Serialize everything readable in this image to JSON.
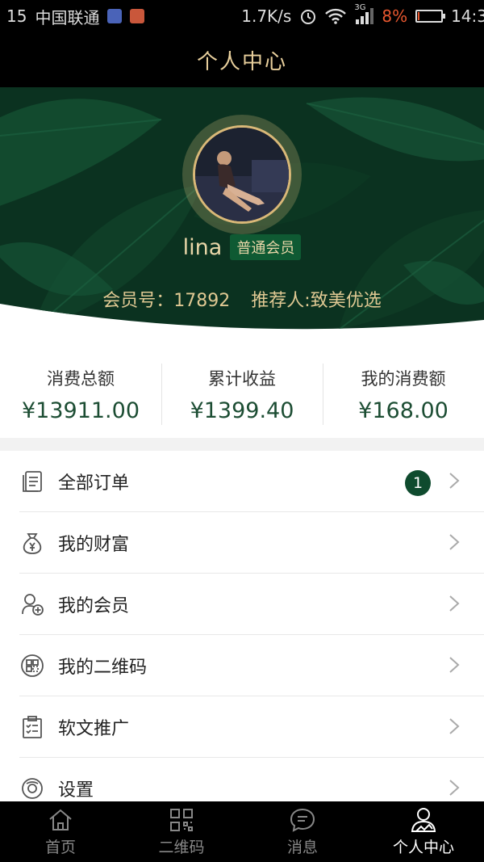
{
  "status_bar": {
    "left_number": "15",
    "carrier": "中国联通",
    "speed": "1.7K/s",
    "network": "3G",
    "battery_percent": "8%",
    "battery_level": 0.08,
    "time": "14:3"
  },
  "header": {
    "title": "个人中心"
  },
  "profile": {
    "username": "lina",
    "level": "普通会员",
    "member_no": "会员号：17892",
    "referrer": "推荐人:致美优选"
  },
  "stats": [
    {
      "label": "消费总额",
      "value": "¥13911.00"
    },
    {
      "label": "累计收益",
      "value": "¥1399.40"
    },
    {
      "label": "我的消费额",
      "value": "¥168.00"
    }
  ],
  "menu": {
    "items": [
      {
        "label": "全部订单",
        "icon": "orders-icon",
        "badge": "1"
      },
      {
        "label": "我的财富",
        "icon": "money-bag-icon"
      },
      {
        "label": "我的会员",
        "icon": "add-member-icon"
      },
      {
        "label": "我的二维码",
        "icon": "qrcode-icon"
      },
      {
        "label": "软文推广",
        "icon": "clipboard-icon"
      },
      {
        "label": "设置",
        "icon": "settings-icon"
      }
    ]
  },
  "tabs": [
    {
      "label": "首页",
      "icon": "home-icon"
    },
    {
      "label": "二维码",
      "icon": "qrcode-icon"
    },
    {
      "label": "消息",
      "icon": "message-icon"
    },
    {
      "label": "个人中心",
      "icon": "user-icon",
      "active": true
    }
  ],
  "colors": {
    "accent_green": "#0f4b2e",
    "gold": "#e0c993",
    "bar_bg": "#000000"
  }
}
